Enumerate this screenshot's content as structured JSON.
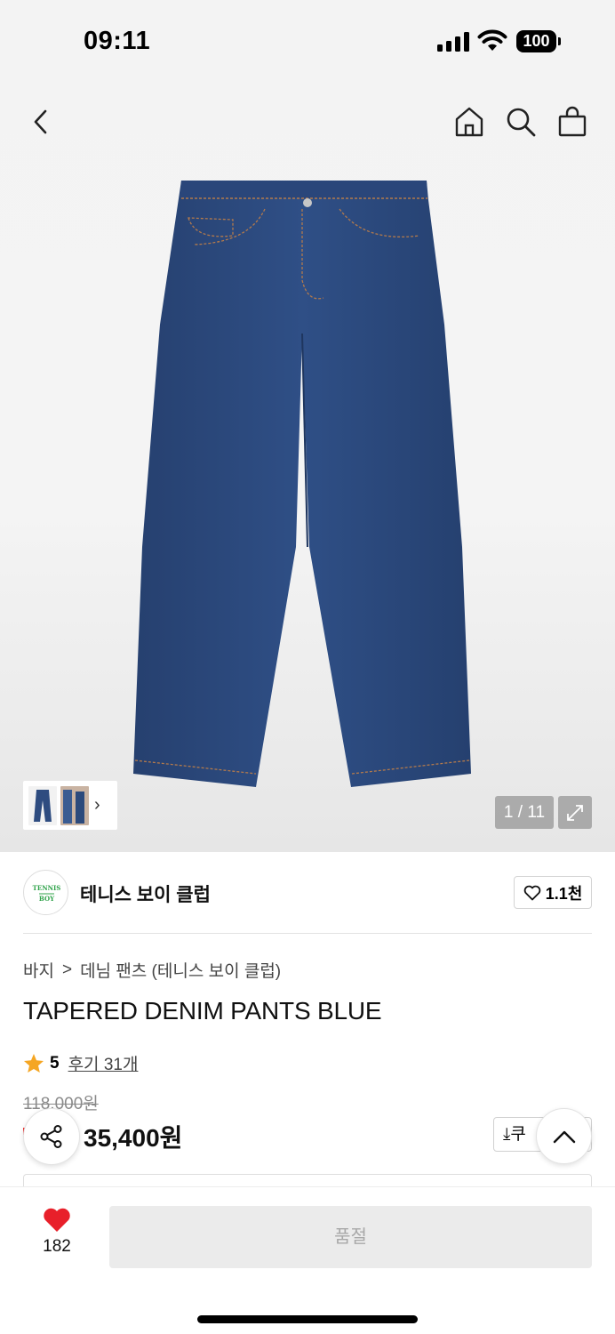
{
  "status_bar": {
    "time": "09:11",
    "battery": "100"
  },
  "nav": {
    "back_icon": "chevron-left-icon",
    "home_icon": "home-icon",
    "search_icon": "search-icon",
    "cart_icon": "shopping-bag-icon"
  },
  "gallery": {
    "counter": "1 / 11",
    "expand_icon": "expand-icon",
    "thumbs_icon": "chevron-right-icon"
  },
  "brand": {
    "name": "테니스 보이 클럽",
    "likes": "1.1천",
    "logo_text_top": "TENNIS",
    "logo_text_bottom": "BOY"
  },
  "breadcrumb": {
    "category": "바지",
    "separator": ">",
    "subcategory": "데님 팬츠 (테니스 보이 클럽)"
  },
  "product": {
    "title": "TAPERED DENIM PANTS BLUE",
    "rating": "5",
    "reviews": "후기 31개",
    "original_price": "118,000원",
    "sale_price": "35,400원"
  },
  "coupon": {
    "label": "⤓쿠"
  },
  "bottom_bar": {
    "like_count": "182",
    "buy_label": "품절"
  },
  "colors": {
    "accent_red": "#e8202a",
    "star": "#f5a623",
    "denim": "#2b4a80"
  }
}
